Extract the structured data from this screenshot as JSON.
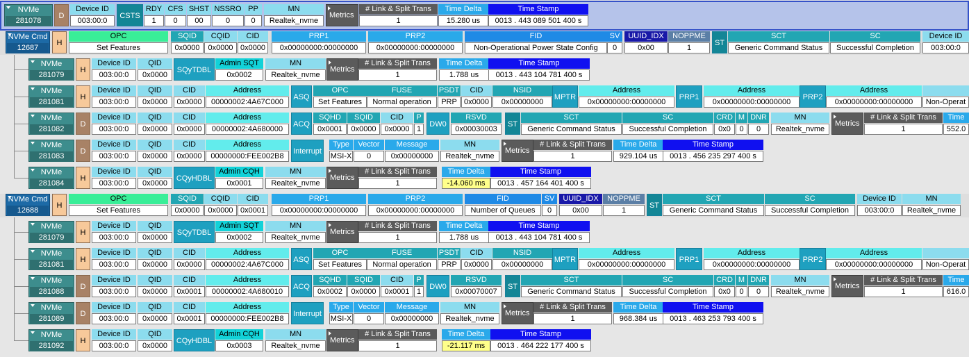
{
  "rows": [
    {
      "kind": "first",
      "packet_label": "NVMe",
      "packet_id": "281078",
      "dir": "D",
      "fields": [
        {
          "h": "Device ID",
          "v": "003:00:0"
        },
        {
          "label": "CSTS"
        },
        {
          "h": "RDY",
          "v": "1"
        },
        {
          "h": "CFS",
          "v": "0"
        },
        {
          "h": "SHST",
          "v": "00"
        },
        {
          "h": "NSSRO",
          "v": "0"
        },
        {
          "h": "PP",
          "v": "0"
        },
        {
          "h": "MN",
          "v": "Realtek_nvme"
        },
        {
          "group": "Metrics"
        },
        {
          "h": "# Link & Split Trans",
          "v": "1"
        },
        {
          "h": "Time Delta",
          "v": "15.280 us"
        },
        {
          "h": "Time Stamp",
          "v": "0013 . 443 089 501 400 s"
        }
      ]
    },
    {
      "kind": "cmd",
      "packet_label": "NVMe Cmd",
      "packet_id": "12687",
      "dir": "H",
      "fields": [
        {
          "h": "OPC",
          "v": "Set Features"
        },
        {
          "h": "SQID",
          "v": "0x0000"
        },
        {
          "h": "CQID",
          "v": "0x0000"
        },
        {
          "h": "CID",
          "v": "0x0000"
        },
        {
          "h": "PRP1",
          "v": "0x00000000:00000000"
        },
        {
          "h": "PRP2",
          "v": "0x00000000:00000000"
        },
        {
          "h": "FID",
          "v": "Non-Operational Power State Config"
        },
        {
          "h": "SV",
          "v": "0"
        },
        {
          "h": "UUID_IDX",
          "v": "0x00"
        },
        {
          "h": "NOPPME",
          "v": "1"
        },
        {
          "label": "ST"
        },
        {
          "h": "SCT",
          "v": "Generic Command Status"
        },
        {
          "h": "SC",
          "v": "Successful Completion"
        },
        {
          "h": "Device ID",
          "v": "003:00:0"
        }
      ]
    },
    {
      "kind": "sub",
      "packet_label": "NVMe",
      "packet_id": "281079",
      "dir": "H",
      "fields": [
        {
          "h": "Device ID",
          "v": "003:00:0"
        },
        {
          "h": "QID",
          "v": "0x0000"
        },
        {
          "label": "SQyTDBL"
        },
        {
          "h": "Admin SQT",
          "v": "0x0002"
        },
        {
          "h": "MN",
          "v": "Realtek_nvme"
        },
        {
          "group": "Metrics"
        },
        {
          "h": "# Link & Split Trans",
          "v": "1"
        },
        {
          "h": "Time Delta",
          "v": "1.788 us"
        },
        {
          "h": "Time Stamp",
          "v": "0013 . 443 104 781 400 s"
        }
      ]
    },
    {
      "kind": "sub",
      "packet_label": "NVMe",
      "packet_id": "281081",
      "dir": "H",
      "fields": [
        {
          "h": "Device ID",
          "v": "003:00:0"
        },
        {
          "h": "QID",
          "v": "0x0000"
        },
        {
          "h": "CID",
          "v": "0x0000"
        },
        {
          "h": "Address",
          "v": "00000002:4A67C000"
        },
        {
          "label": "ASQ"
        },
        {
          "h": "OPC",
          "v": "Set Features"
        },
        {
          "h": "FUSE",
          "v": "Normal operation"
        },
        {
          "h": "PSDT",
          "v": "PRP"
        },
        {
          "h": "CID",
          "v": "0x0000"
        },
        {
          "h": "NSID",
          "v": "0x00000000"
        },
        {
          "label": "MPTR"
        },
        {
          "h": "Address",
          "v": "0x00000000:00000000"
        },
        {
          "label": "PRP1"
        },
        {
          "h": "Address",
          "v": "0x00000000:00000000"
        },
        {
          "label": "PRP2"
        },
        {
          "h": "Address",
          "v": "0x00000000:00000000"
        },
        {
          "h": "",
          "v": "Non-Operat"
        }
      ]
    },
    {
      "kind": "sub",
      "packet_label": "NVMe",
      "packet_id": "281082",
      "dir": "D",
      "fields": [
        {
          "h": "Device ID",
          "v": "003:00:0"
        },
        {
          "h": "QID",
          "v": "0x0000"
        },
        {
          "h": "CID",
          "v": "0x0000"
        },
        {
          "h": "Address",
          "v": "00000002:4A680000"
        },
        {
          "label": "ACQ"
        },
        {
          "h": "SQHD",
          "v": "0x0001"
        },
        {
          "h": "SQID",
          "v": "0x0000"
        },
        {
          "h": "CID",
          "v": "0x0000"
        },
        {
          "h": "P",
          "v": "1"
        },
        {
          "label": "DW0"
        },
        {
          "h": "RSVD",
          "v": "0x00030003"
        },
        {
          "label": "ST"
        },
        {
          "h": "SCT",
          "v": "Generic Command Status"
        },
        {
          "h": "SC",
          "v": "Successful Completion"
        },
        {
          "h": "CRD",
          "v": "0x0"
        },
        {
          "h": "M",
          "v": "0"
        },
        {
          "h": "DNR",
          "v": "0"
        },
        {
          "h": "MN",
          "v": "Realtek_nvme"
        },
        {
          "group": "Metrics"
        },
        {
          "h": "# Link & Split Trans",
          "v": "1"
        },
        {
          "h": "Time",
          "v": "552.0"
        }
      ]
    },
    {
      "kind": "sub",
      "packet_label": "NVMe",
      "packet_id": "281083",
      "dir": "D",
      "fields": [
        {
          "h": "Device ID",
          "v": "003:00:0"
        },
        {
          "h": "QID",
          "v": "0x0000"
        },
        {
          "h": "CID",
          "v": "0x0000"
        },
        {
          "h": "Address",
          "v": "00000000:FEE002B8"
        },
        {
          "label": "Interrupt"
        },
        {
          "h": "Type",
          "v": "MSI-X"
        },
        {
          "h": "Vector",
          "v": "0"
        },
        {
          "h": "Message",
          "v": "0x00000000"
        },
        {
          "h": "MN",
          "v": "Realtek_nvme"
        },
        {
          "group": "Metrics"
        },
        {
          "h": "# Link & Split Trans",
          "v": "1"
        },
        {
          "h": "Time Delta",
          "v": "929.104 us"
        },
        {
          "h": "Time Stamp",
          "v": "0013 . 456 235 297 400 s"
        }
      ]
    },
    {
      "kind": "sub",
      "packet_label": "NVMe",
      "packet_id": "281084",
      "dir": "H",
      "fields": [
        {
          "h": "Device ID",
          "v": "003:00:0"
        },
        {
          "h": "QID",
          "v": "0x0000"
        },
        {
          "label": "CQyHDBL"
        },
        {
          "h": "Admin CQH",
          "v": "0x0001"
        },
        {
          "h": "MN",
          "v": "Realtek_nvme"
        },
        {
          "group": "Metrics"
        },
        {
          "h": "# Link & Split Trans",
          "v": "1"
        },
        {
          "h": "Time Delta",
          "v": "-14.060 ms",
          "warn": true
        },
        {
          "h": "Time Stamp",
          "v": "0013 . 457 164 401 400 s"
        }
      ]
    },
    {
      "kind": "cmd",
      "packet_label": "NVMe Cmd",
      "packet_id": "12688",
      "dir": "H",
      "fields": [
        {
          "h": "OPC",
          "v": "Set Features"
        },
        {
          "h": "SQID",
          "v": "0x0000"
        },
        {
          "h": "CQID",
          "v": "0x0000"
        },
        {
          "h": "CID",
          "v": "0x0001"
        },
        {
          "h": "PRP1",
          "v": "0x00000000:00000000"
        },
        {
          "h": "PRP2",
          "v": "0x00000000:00000000"
        },
        {
          "h": "FID",
          "v": "Number of Queues"
        },
        {
          "h": "SV",
          "v": "0"
        },
        {
          "h": "UUID_IDX",
          "v": "0x00"
        },
        {
          "h": "NOPPME",
          "v": "1"
        },
        {
          "label": "ST"
        },
        {
          "h": "SCT",
          "v": "Generic Command Status"
        },
        {
          "h": "SC",
          "v": "Successful Completion"
        },
        {
          "h": "Device ID",
          "v": "003:00:0"
        },
        {
          "h": "MN",
          "v": "Realtek_nvme"
        }
      ]
    },
    {
      "kind": "sub",
      "packet_label": "NVMe",
      "packet_id": "281079",
      "dir": "H",
      "fields": [
        {
          "h": "Device ID",
          "v": "003:00:0"
        },
        {
          "h": "QID",
          "v": "0x0000"
        },
        {
          "label": "SQyTDBL"
        },
        {
          "h": "Admin SQT",
          "v": "0x0002"
        },
        {
          "h": "MN",
          "v": "Realtek_nvme"
        },
        {
          "group": "Metrics"
        },
        {
          "h": "# Link & Split Trans",
          "v": "1"
        },
        {
          "h": "Time Delta",
          "v": "1.788 us"
        },
        {
          "h": "Time Stamp",
          "v": "0013 . 443 104 781 400 s"
        }
      ]
    },
    {
      "kind": "sub",
      "packet_label": "NVMe",
      "packet_id": "281081",
      "dir": "H",
      "fields": [
        {
          "h": "Device ID",
          "v": "003:00:0"
        },
        {
          "h": "QID",
          "v": "0x0000"
        },
        {
          "h": "CID",
          "v": "0x0000"
        },
        {
          "h": "Address",
          "v": "00000002:4A67C000"
        },
        {
          "label": "ASQ"
        },
        {
          "h": "OPC",
          "v": "Set Features"
        },
        {
          "h": "FUSE",
          "v": "Normal operation"
        },
        {
          "h": "PSDT",
          "v": "PRP"
        },
        {
          "h": "CID",
          "v": "0x0000"
        },
        {
          "h": "NSID",
          "v": "0x00000000"
        },
        {
          "label": "MPTR"
        },
        {
          "h": "Address",
          "v": "0x00000000:00000000"
        },
        {
          "label": "PRP1"
        },
        {
          "h": "Address",
          "v": "0x00000000:00000000"
        },
        {
          "label": "PRP2"
        },
        {
          "h": "Address",
          "v": "0x00000000:00000000"
        },
        {
          "h": "",
          "v": "Non-Operat"
        }
      ]
    },
    {
      "kind": "sub",
      "packet_label": "NVMe",
      "packet_id": "281088",
      "dir": "D",
      "fields": [
        {
          "h": "Device ID",
          "v": "003:00:0"
        },
        {
          "h": "QID",
          "v": "0x0000"
        },
        {
          "h": "CID",
          "v": "0x0001"
        },
        {
          "h": "Address",
          "v": "00000002:4A680010"
        },
        {
          "label": "ACQ"
        },
        {
          "h": "SQHD",
          "v": "0x0002"
        },
        {
          "h": "SQID",
          "v": "0x0000"
        },
        {
          "h": "CID",
          "v": "0x0001"
        },
        {
          "h": "P",
          "v": "1"
        },
        {
          "label": "DW0"
        },
        {
          "h": "RSVD",
          "v": "0x00070007"
        },
        {
          "label": "ST"
        },
        {
          "h": "SCT",
          "v": "Generic Command Status"
        },
        {
          "h": "SC",
          "v": "Successful Completion"
        },
        {
          "h": "CRD",
          "v": "0x0"
        },
        {
          "h": "M",
          "v": "0"
        },
        {
          "h": "DNR",
          "v": "0"
        },
        {
          "h": "MN",
          "v": "Realtek_nvme"
        },
        {
          "group": "Metrics"
        },
        {
          "h": "# Link & Split Trans",
          "v": "1"
        },
        {
          "h": "Time",
          "v": "616.0"
        }
      ]
    },
    {
      "kind": "sub",
      "packet_label": "NVMe",
      "packet_id": "281089",
      "dir": "D",
      "fields": [
        {
          "h": "Device ID",
          "v": "003:00:0"
        },
        {
          "h": "QID",
          "v": "0x0000"
        },
        {
          "h": "CID",
          "v": "0x0001"
        },
        {
          "h": "Address",
          "v": "00000000:FEE002B8"
        },
        {
          "label": "Interrupt"
        },
        {
          "h": "Type",
          "v": "MSI-X"
        },
        {
          "h": "Vector",
          "v": "0"
        },
        {
          "h": "Message",
          "v": "0x00000000"
        },
        {
          "h": "MN",
          "v": "Realtek_nvme"
        },
        {
          "group": "Metrics"
        },
        {
          "h": "# Link & Split Trans",
          "v": "1"
        },
        {
          "h": "Time Delta",
          "v": "968.384 us"
        },
        {
          "h": "Time Stamp",
          "v": "0013 . 463 253 793 400 s"
        }
      ]
    },
    {
      "kind": "sub",
      "packet_label": "NVMe",
      "packet_id": "281092",
      "dir": "H",
      "fields": [
        {
          "h": "Device ID",
          "v": "003:00:0"
        },
        {
          "h": "QID",
          "v": "0x0000"
        },
        {
          "label": "CQyHDBL"
        },
        {
          "h": "Admin CQH",
          "v": "0x0003"
        },
        {
          "h": "MN",
          "v": "Realtek_nvme"
        },
        {
          "group": "Metrics"
        },
        {
          "h": "# Link & Split Trans",
          "v": "1"
        },
        {
          "h": "Time Delta",
          "v": "-21.117 ms",
          "warn": true
        },
        {
          "h": "Time Stamp",
          "v": "0013 . 464 222 177 400 s"
        }
      ]
    }
  ],
  "colors": {
    "packet_teal": "#3d8d8d",
    "packet_cmd": "#1d6aa6",
    "selected_row_bg": "#b5c3ea",
    "selected_row_border": "#3552c8",
    "host_dir": "#f7c99a",
    "device_dir": "#a88266",
    "warn_value": "#ffff8a"
  }
}
